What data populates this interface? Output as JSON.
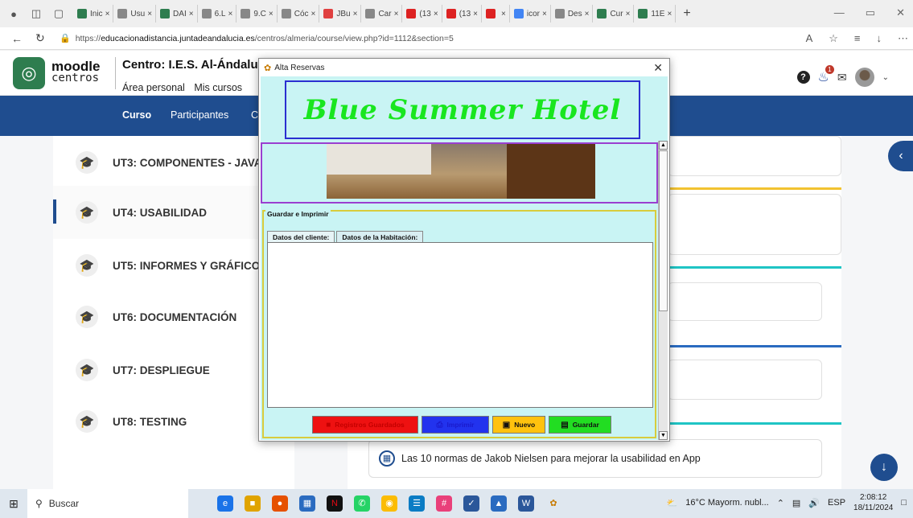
{
  "browser": {
    "tabs": [
      {
        "label": "Inic",
        "color": "#2e7d4f"
      },
      {
        "label": "Usu",
        "color": "#888888"
      },
      {
        "label": "DAI",
        "color": "#2e7d4f"
      },
      {
        "label": "6.L",
        "color": "#888888"
      },
      {
        "label": "9.C",
        "color": "#888888"
      },
      {
        "label": "Cóc",
        "color": "#888888"
      },
      {
        "label": "JBu",
        "color": "#e04040"
      },
      {
        "label": "Car",
        "color": "#888888"
      },
      {
        "label": "(13",
        "color": "#d22"
      },
      {
        "label": "(13",
        "color": "#d22"
      },
      {
        "label": "",
        "color": "#d22"
      },
      {
        "label": "icor",
        "color": "#4285f4"
      },
      {
        "label": "Des",
        "color": "#888888"
      },
      {
        "label": "Cur",
        "color": "#2e7d4f"
      },
      {
        "label": "11E",
        "color": "#2e7d4f"
      }
    ],
    "url_prefix": "https://",
    "url_domain": "educacionadistancia.juntadeandalucia.es",
    "url_path": "/centros/almeria/course/view.php?id=1112&section=5"
  },
  "moodle": {
    "logo_top": "moodle",
    "logo_bottom": "centros",
    "centro": "Centro: I.E.S. Al-Ándalus",
    "nav": [
      "Área personal",
      "Mis cursos"
    ],
    "badge_count": "1",
    "course_tabs": [
      "Curso",
      "Participantes",
      "C"
    ]
  },
  "units": [
    {
      "label": "UT3: COMPONENTES - JAVA"
    },
    {
      "label": "UT4: USABILIDAD"
    },
    {
      "label": "UT5: INFORMES Y GRÁFICOS"
    },
    {
      "label": "UT6: DOCUMENTACIÓN"
    },
    {
      "label": "UT7: DESPLIEGUE"
    },
    {
      "label": "UT8: TESTING"
    }
  ],
  "right": {
    "nielsen": "Las 10 normas de Jakob Nielsen para mejorar la usabilidad en App"
  },
  "dialog": {
    "title": "Alta Reservas",
    "hotel_name": "Blue Summer Hotel",
    "group_title": "Guardar e Imprimir",
    "tabs": [
      "Datos del cliente:",
      "Datos de la Habitación:"
    ],
    "buttons": [
      {
        "label": "Registros Guardados",
        "bg": "#ee1111",
        "fg": "#c40000"
      },
      {
        "label": "Imprimir",
        "bg": "#2233ee",
        "fg": "#1a1acc"
      },
      {
        "label": "Nuevo",
        "bg": "#ffc20e",
        "fg": "#111111"
      },
      {
        "label": "Guardar",
        "bg": "#22dd22",
        "fg": "#111111"
      }
    ]
  },
  "taskbar": {
    "search": "Buscar",
    "weather": "16°C  Mayorm. nubl...",
    "lang": "ESP",
    "time": "2:08:12",
    "date": "18/11/2024"
  }
}
